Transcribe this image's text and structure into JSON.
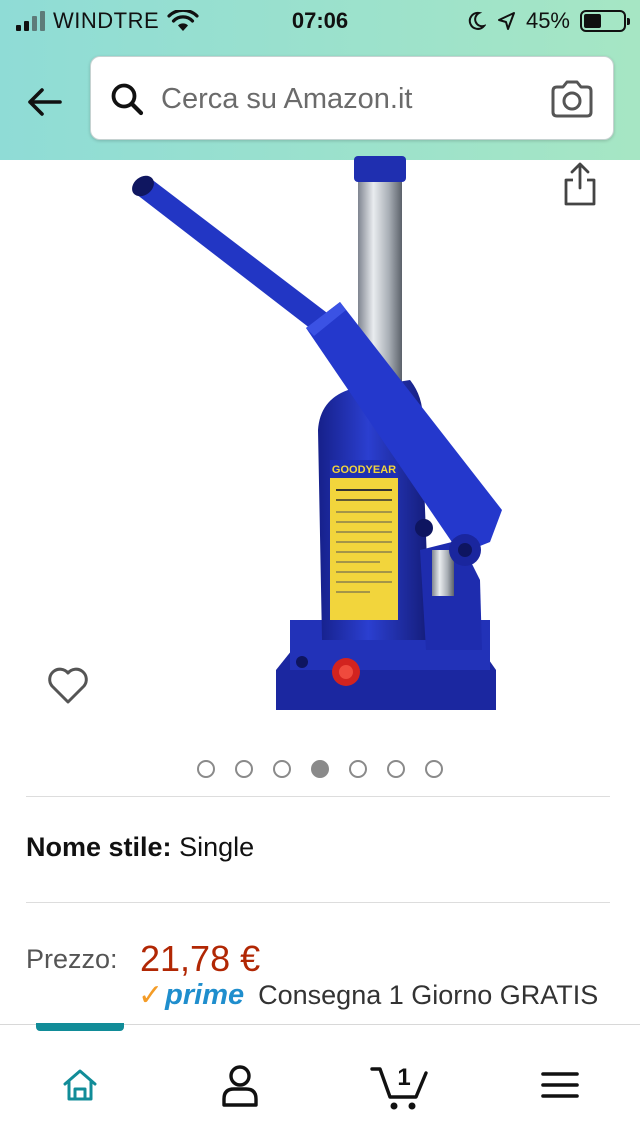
{
  "status_bar": {
    "carrier": "WINDTRE",
    "time": "07:06",
    "battery": "45%",
    "battery_level": 0.45,
    "signal_bars": 4,
    "signal_bars_active": 2
  },
  "search": {
    "placeholder": "Cerca su Amazon.it",
    "value": ""
  },
  "product": {
    "image_brand_text": "GOODYEAR",
    "image_alt": "Crick idraulico blu",
    "carousel": {
      "count": 7,
      "active_index": 3
    },
    "style_label": "Nome stile:",
    "style_value": "Single",
    "price_label": "Prezzo:",
    "price_value": "21,78 €",
    "prime_check": "✓",
    "prime_word": "prime",
    "delivery_text": "Consegna 1 Giorno GRATIS"
  },
  "bottom_nav": {
    "cart_count": "1",
    "items": [
      "home-icon",
      "account-icon",
      "cart-icon",
      "menu-icon"
    ],
    "active": "home"
  },
  "colors": {
    "header_gradient_start": "#8fdcd6",
    "header_gradient_end": "#a6e6c4",
    "price": "#b12704",
    "prime_blue": "#1f8ecd",
    "prime_orange": "#f49c27",
    "nav_active": "#118c98",
    "product_blue": "#1e2fb4",
    "product_yellow": "#f2d53c"
  }
}
